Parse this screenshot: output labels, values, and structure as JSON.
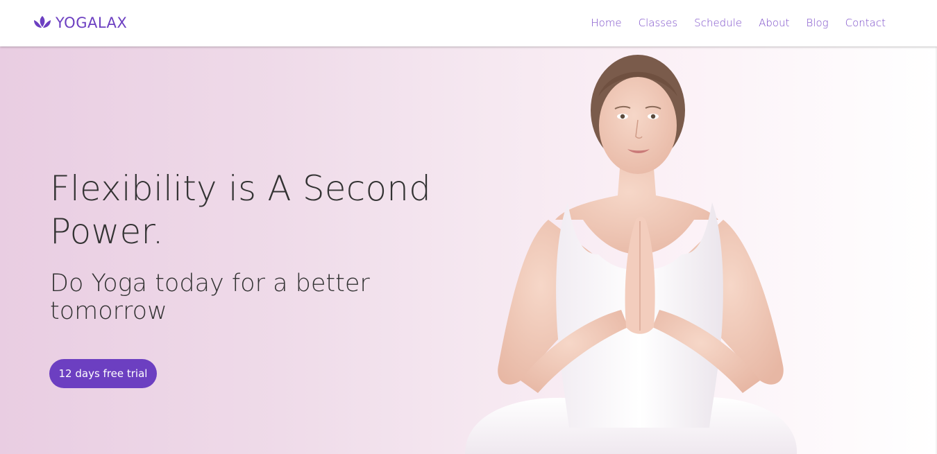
{
  "brand": {
    "name": "YOGALAX",
    "icon": "lotus-icon",
    "color": "#6c3fc1"
  },
  "nav": {
    "items": [
      {
        "label": "Home"
      },
      {
        "label": "Classes"
      },
      {
        "label": "Schedule"
      },
      {
        "label": "About"
      },
      {
        "label": "Blog"
      },
      {
        "label": "Contact"
      }
    ],
    "link_color": "#7b4cc9"
  },
  "hero": {
    "headline": "Flexibility is A Second Power.",
    "subheadline": "Do Yoga today for a better tomorrow",
    "cta_label": "12 days free trial",
    "cta_color": "#6c3fc1",
    "image": "woman-meditating-in-white-clothes"
  }
}
